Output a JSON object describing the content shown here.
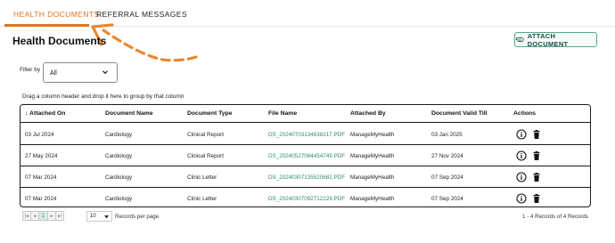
{
  "tabs": [
    {
      "label": "HEALTH DOCUMENTS",
      "active": true
    },
    {
      "label": "REFERRAL MESSAGES",
      "active": false
    }
  ],
  "page_title": "Health Documents",
  "attach_button": {
    "label": "ATTACH DOCUMENT",
    "icon": "paperclip-icon"
  },
  "filter": {
    "label": "Filter by",
    "value": "All"
  },
  "group_hint": "Drag a column header and drop it here to group by that column",
  "columns": [
    "↓ Attached On",
    "Document Name",
    "Document Type",
    "File Name",
    "Attached By",
    "Document Valid Till",
    "Actions"
  ],
  "rows": [
    {
      "attached_on": "03 Jul 2024",
      "document_name": "Cardiology",
      "document_type": "Clinical Report",
      "file_name": "DS_20240703134638217.PDF",
      "attached_by": "ManageMyHealth",
      "valid_till": "03 Jan 2025"
    },
    {
      "attached_on": "27 May 2024",
      "document_name": "Cardiology",
      "document_type": "Clinical Report",
      "file_name": "DS_20240527084454749.PDF",
      "attached_by": "ManageMyHealth",
      "valid_till": "27 Nov 2024"
    },
    {
      "attached_on": "07 Mar 2024",
      "document_name": "Cardiology",
      "document_type": "Clinic Letter",
      "file_name": "DS_20240307135520682.PDF",
      "attached_by": "ManageMyHealth",
      "valid_till": "07 Sep 2024"
    },
    {
      "attached_on": "07 Mar 2024",
      "document_name": "Cardiology",
      "document_type": "Clinic Letter",
      "file_name": "DS_20240307092712229.PDF",
      "attached_by": "ManageMyHealth",
      "valid_till": "07 Sep 2024"
    }
  ],
  "pager": {
    "first": "|◂",
    "prev": "◂",
    "current_page": "1",
    "next": "▸",
    "last": "▸|",
    "page_size": "10",
    "per_page_label": "Records per page",
    "records_summary": "1 - 4 Records of 4 Records"
  },
  "colors": {
    "accent": "#e07420",
    "teal": "#4dab8f",
    "link": "#2e8c6a"
  }
}
